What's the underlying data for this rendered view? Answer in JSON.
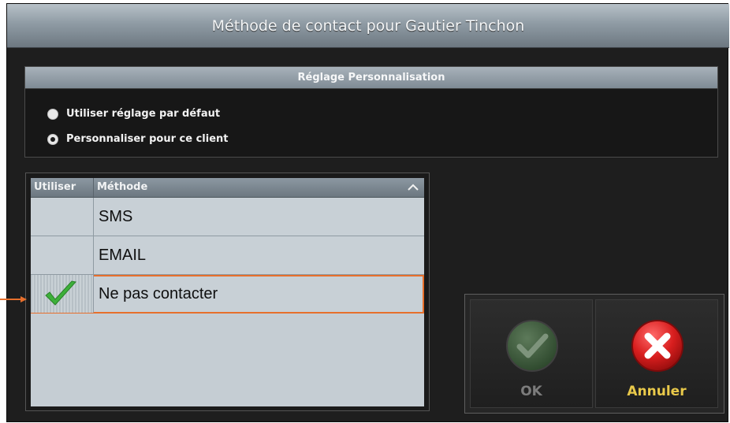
{
  "dialog": {
    "title": "Méthode de contact pour Gautier Tinchon"
  },
  "settings": {
    "header": "Réglage Personnalisation",
    "options": [
      {
        "label": "Utiliser réglage par défaut",
        "selected": false
      },
      {
        "label": "Personnaliser pour ce client",
        "selected": true
      }
    ]
  },
  "table": {
    "columns": [
      "Utiliser",
      "Méthode"
    ],
    "sort_icon": "chevron-up-icon",
    "rows": [
      {
        "method": "SMS",
        "use": false
      },
      {
        "method": "EMAIL",
        "use": false
      },
      {
        "method": "Ne pas contacter",
        "use": true,
        "selected": true
      }
    ]
  },
  "buttons": {
    "ok_label": "OK",
    "cancel_label": "Annuler"
  },
  "colors": {
    "highlight": "#e76f2c",
    "cancel_text": "#e9c94a",
    "ok_text_disabled": "#7c7c7c",
    "check_green": "#3db03a"
  }
}
